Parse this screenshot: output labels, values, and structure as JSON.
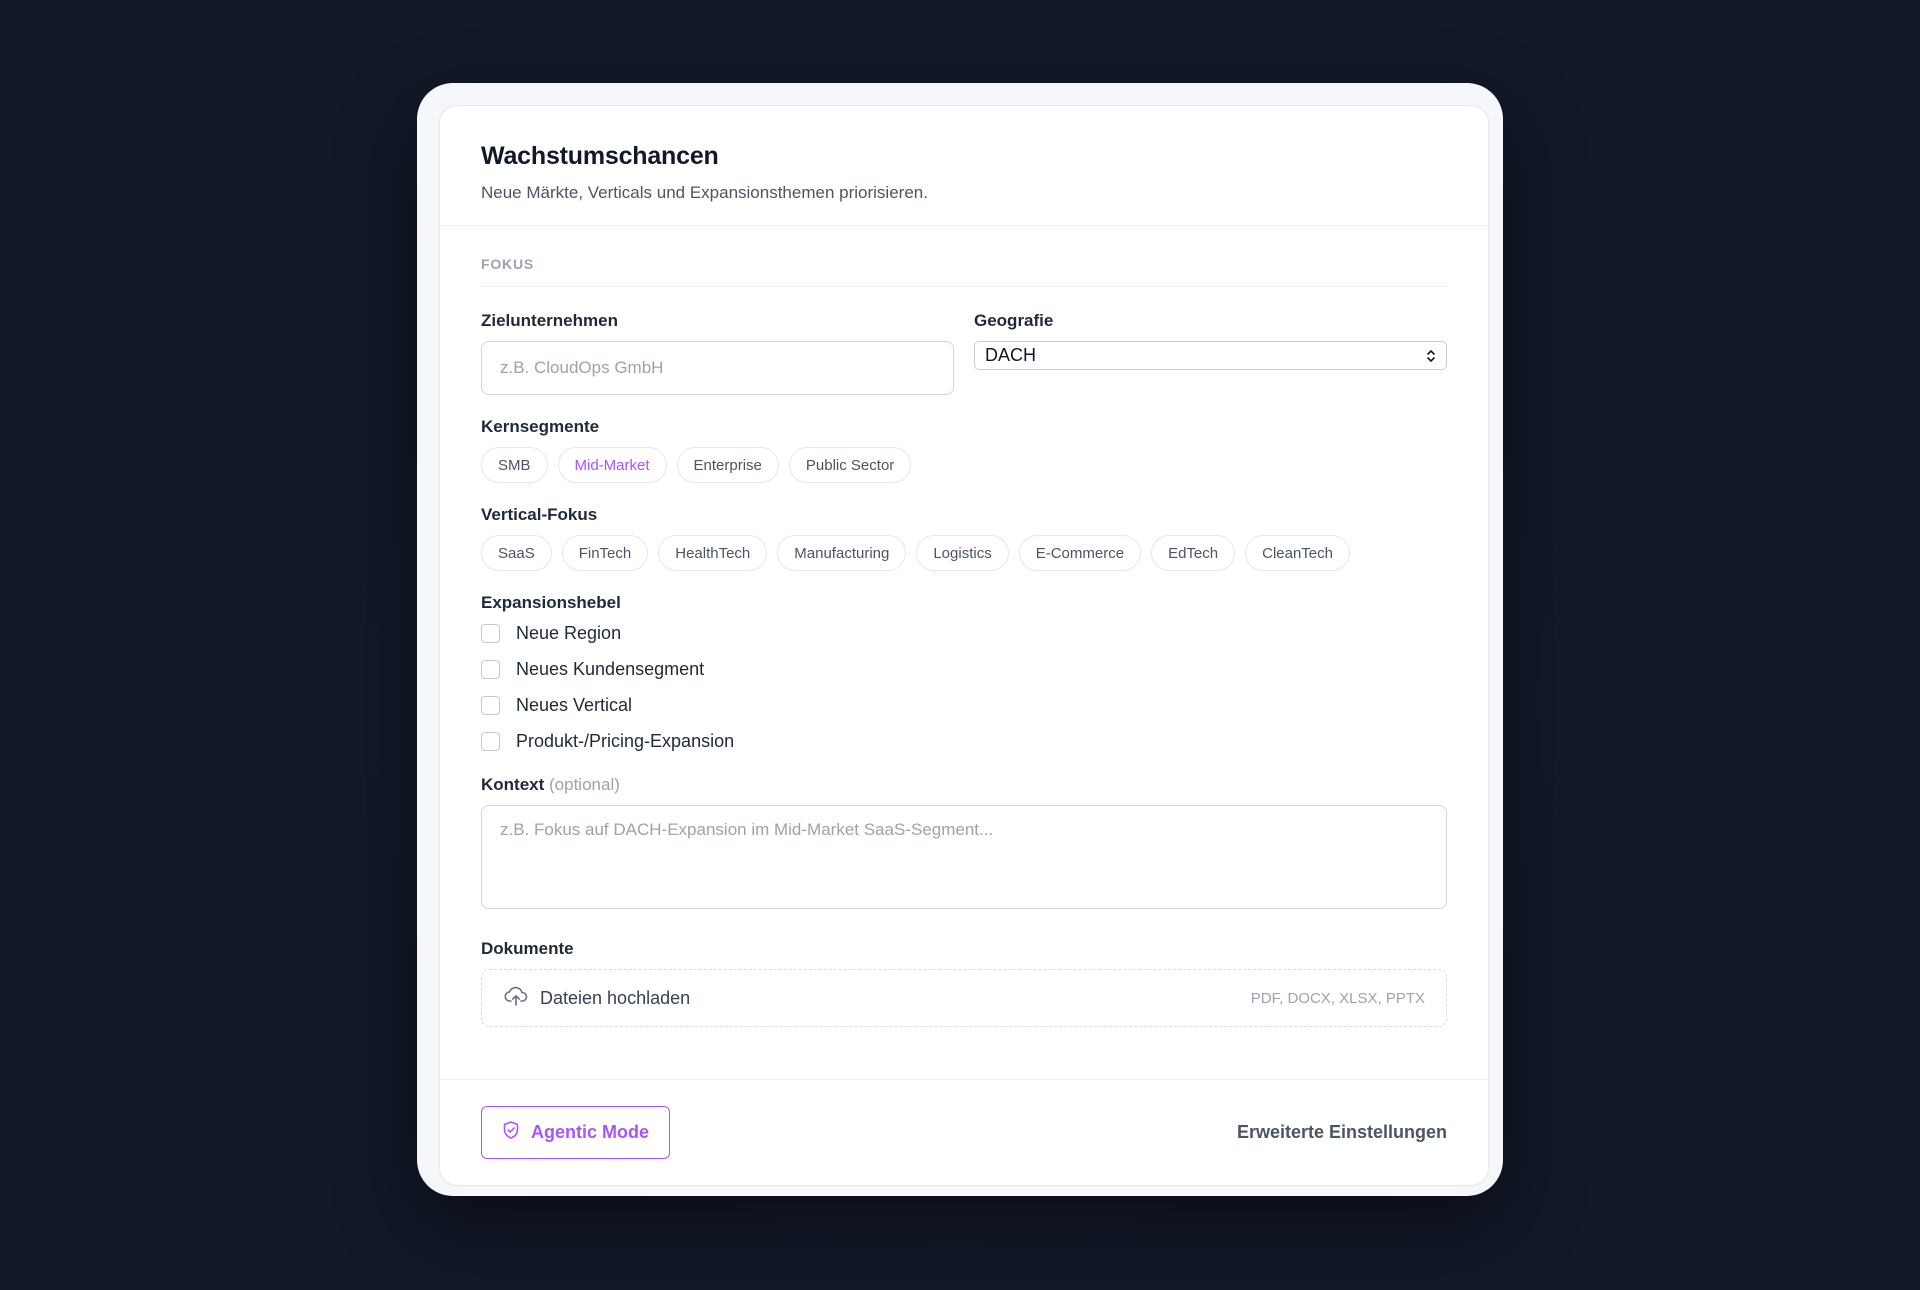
{
  "header": {
    "title": "Wachstumschancen",
    "subtitle": "Neue Märkte, Verticals und Expansionsthemen priorisieren."
  },
  "section": {
    "label": "FOKUS"
  },
  "target_company": {
    "label": "Zielunternehmen",
    "value": "",
    "placeholder": "z.B. CloudOps GmbH"
  },
  "geography": {
    "label": "Geografie",
    "selected": "DACH"
  },
  "core_segments": {
    "label": "Kernsegmente",
    "items": [
      {
        "label": "SMB",
        "active": false
      },
      {
        "label": "Mid-Market",
        "active": true
      },
      {
        "label": "Enterprise",
        "active": false
      },
      {
        "label": "Public Sector",
        "active": false
      }
    ]
  },
  "vertical_focus": {
    "label": "Vertical-Fokus",
    "items": [
      {
        "label": "SaaS",
        "active": false
      },
      {
        "label": "FinTech",
        "active": false
      },
      {
        "label": "HealthTech",
        "active": false
      },
      {
        "label": "Manufacturing",
        "active": false
      },
      {
        "label": "Logistics",
        "active": false
      },
      {
        "label": "E-Commerce",
        "active": false
      },
      {
        "label": "EdTech",
        "active": false
      },
      {
        "label": "CleanTech",
        "active": false
      }
    ]
  },
  "expansion_levers": {
    "label": "Expansionshebel",
    "items": [
      {
        "label": "Neue Region",
        "checked": false
      },
      {
        "label": "Neues Kundensegment",
        "checked": false
      },
      {
        "label": "Neues Vertical",
        "checked": false
      },
      {
        "label": "Produkt-/Pricing-Expansion",
        "checked": false
      }
    ]
  },
  "context": {
    "label": "Kontext",
    "optional": "(optional)",
    "value": "",
    "placeholder": "z.B. Fokus auf DACH-Expansion im Mid-Market SaaS-Segment..."
  },
  "documents": {
    "label": "Dokumente",
    "upload_label": "Dateien hochladen",
    "formats": "PDF, DOCX, XLSX, PPTX"
  },
  "footer": {
    "agentic_label": "Agentic Mode",
    "settings_label": "Erweiterte Einstellungen"
  },
  "colors": {
    "accent": "#a855f7",
    "background": "#121828",
    "card": "#ffffff"
  },
  "icons": {
    "upload": "cloud-upload-icon",
    "agentic": "shield-check-icon",
    "select": "chevron-up-down-icon"
  }
}
